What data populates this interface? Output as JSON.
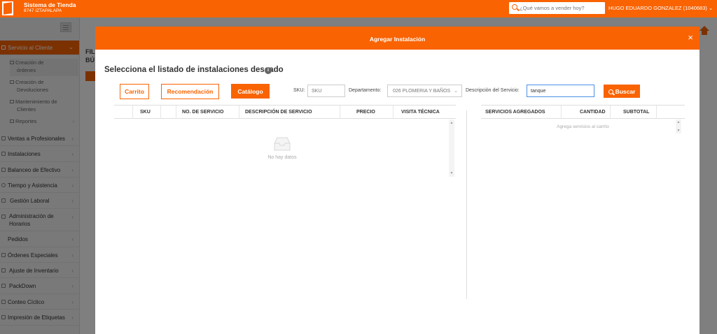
{
  "topbar": {
    "brand_title": "Sistema de Tienda",
    "brand_subtitle": "8747 IZTAPALAPA",
    "search_placeholder": "¿Qué vamos a vender hoy?",
    "user": "HUGO EDUARDO GONZALEZ (1040683)",
    "user_chevron": "⌄"
  },
  "sidebar": {
    "active": {
      "label": "Servicio al Cliente",
      "chevron": "⌄"
    },
    "subitems": [
      {
        "label_1": "Creación de",
        "label_2": "órdenes"
      },
      {
        "label_1": "Creación de",
        "label_2": "Devoluciones"
      },
      {
        "label_1": "Mantenimiento de",
        "label_2": "Clientes"
      },
      {
        "label_1": "Reportes",
        "chevron": "‹"
      }
    ],
    "items": [
      {
        "label": "Ventas a Profesionales",
        "chevron": "‹"
      },
      {
        "label": "Instalaciones",
        "chevron": "‹"
      },
      {
        "label": "Balanceo de Efectivo",
        "chevron": "‹"
      },
      {
        "label": "Tiempo y Asistencia",
        "chevron": "‹"
      },
      {
        "label": "Gestión Laboral",
        "chevron": "‹"
      },
      {
        "label": "Administración de",
        "label_2": "Horarios",
        "chevron": "‹"
      },
      {
        "label": "Pedidos",
        "chevron": "‹"
      },
      {
        "label": "Órdenes Especiales",
        "chevron": "‹"
      },
      {
        "label": "Ajuste de Inventario",
        "chevron": "‹"
      },
      {
        "label": "PackDown",
        "chevron": "‹"
      },
      {
        "label": "Conteo Cíclico",
        "chevron": "‹"
      },
      {
        "label": "Impresión de Etiquetas",
        "chevron": "‹"
      }
    ]
  },
  "background": {
    "fil": "FIL",
    "bu": "BÚ"
  },
  "modal": {
    "title": "Agregar Instalación",
    "close": "×",
    "heading": "Selecciona el listado de instalaciones deseado",
    "info": "i",
    "buttons": {
      "carrito": "Carrito",
      "recomendacion": "Recomendación",
      "catalogo": "Catálogo"
    },
    "filters": {
      "sku_label": "SKU:",
      "sku_placeholder": "SKU",
      "dept_label": "Departamento:",
      "dept_value": "026 PLOMERIA Y BAÑOS",
      "dept_chevron": "⌄",
      "desc_label": "Descripción del Servicio:",
      "desc_value": "tanque",
      "search_button": "Buscar"
    },
    "catalog_table": {
      "columns": [
        "SKU",
        "NO. DE SERVICIO",
        "DESCRIPCIÓN DE SERVICIO",
        "PRECIO",
        "VISITA TÉCNICA"
      ],
      "empty_text": "No hay datos"
    },
    "cart_table": {
      "columns": [
        "SERVICIOS AGREGADOS",
        "CANTIDAD",
        "SUBTOTAL"
      ],
      "empty_text": "Agrega servicios al carrito"
    }
  },
  "colors": {
    "brand_orange": "#f96302",
    "focus_blue": "#4a90e2"
  }
}
